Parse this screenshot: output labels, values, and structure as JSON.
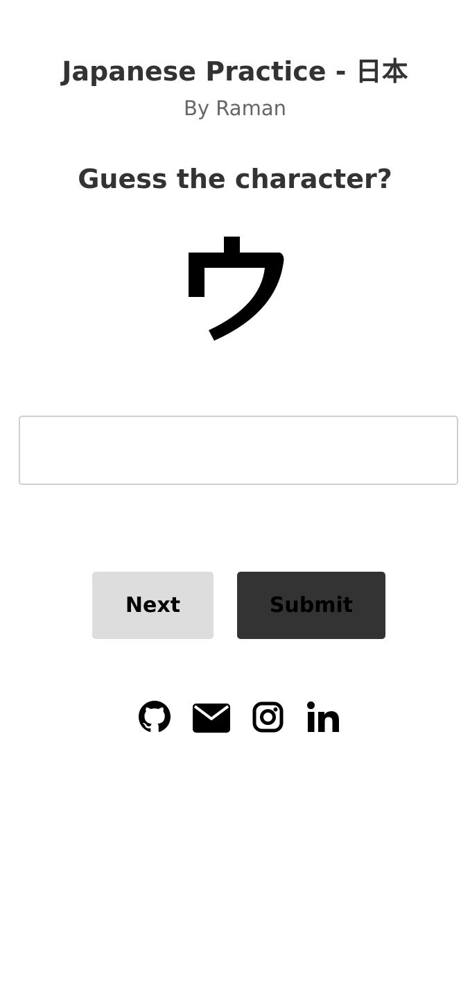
{
  "header": {
    "title": "Japanese Practice - 日本",
    "author": "By Raman"
  },
  "quiz": {
    "prompt": "Guess the character?",
    "character": "ウ",
    "answer_value": "",
    "answer_placeholder": ""
  },
  "actions": {
    "next_label": "Next",
    "submit_label": "Submit"
  },
  "socials": [
    {
      "icon": "github-icon"
    },
    {
      "icon": "envelope-icon"
    },
    {
      "icon": "instagram-icon"
    },
    {
      "icon": "linkedin-icon"
    }
  ],
  "colors": {
    "text": "#333333",
    "muted": "#666666",
    "next_bg": "#dddddd",
    "submit_bg": "#333333",
    "input_border": "#cfcfcf"
  }
}
